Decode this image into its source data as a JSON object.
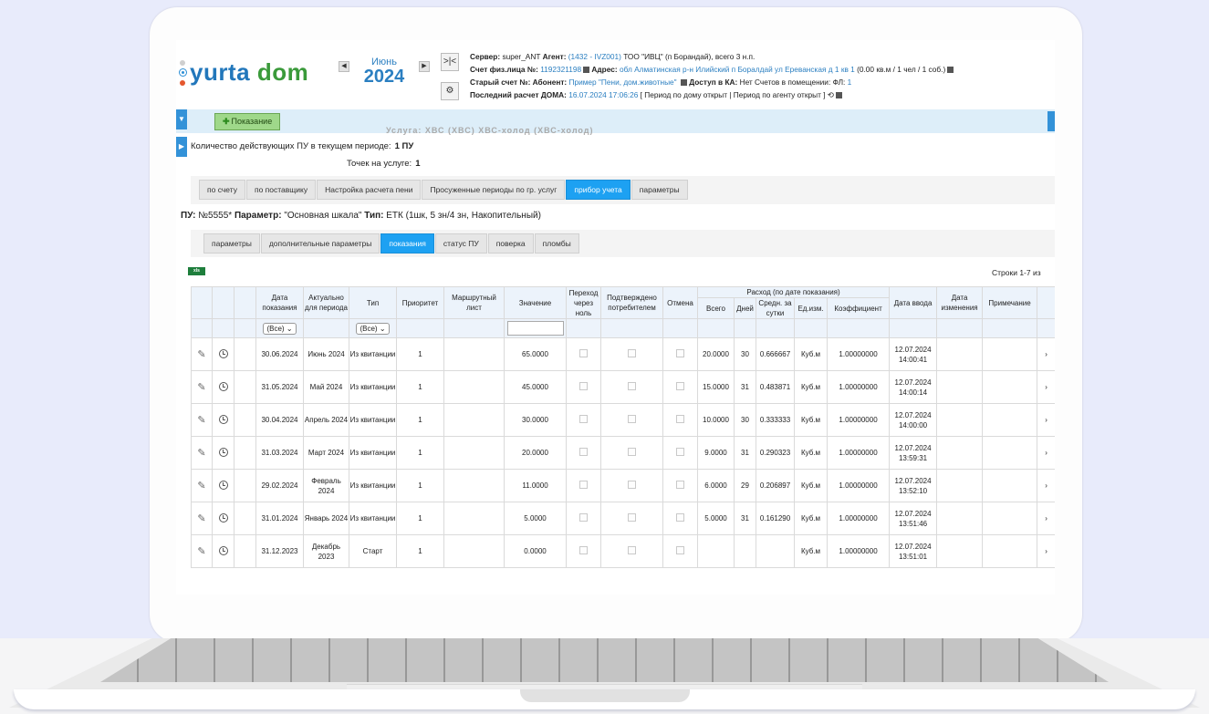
{
  "app": {
    "logo_left": "yurta",
    "logo_right": "dom"
  },
  "period": {
    "month": "Июнь",
    "year": "2024",
    "nav_prev": "◀",
    "nav_next": "▶"
  },
  "side_buttons": {
    "shift": ">|<",
    "settings": "⚙"
  },
  "info": {
    "server_label": "Сервер:",
    "server": "super_ANT",
    "agent_label": "Агент:",
    "agent_link": "(1432 - IVZ001)",
    "agent_rest": "ТОО \"ИВЦ\" (п Борандай), всего 3 н.п.",
    "account_label": "Счет физ.лица №:",
    "account": "1192321198",
    "address_label": "Адрес:",
    "address": "обл Алматинская р-н Илийский п Боралдай ул Ереванская д 1 кв 1",
    "address_rest": "(0.00 кв.м / 1 чел / 1 соб.)",
    "old_label": "Старый счет №:",
    "subscriber_label": "Абонент:",
    "subscriber": "Пример \"Пени, дом.животные\"",
    "access_label": "Доступ в КА:",
    "access": "Нет Счетов в помещении:",
    "fl_label": "ФЛ:",
    "fl": "1",
    "last_label": "Последний расчет ДОМА:",
    "last_date": "16.07.2024 17:06:26",
    "last_rest": "[ Период по дому открыт | Период по агенту открыт ]"
  },
  "toolbar": {
    "pokazanie": "Показание",
    "ghost": "Услуга: ХВС (ХВС) ХВС-холод (ХВС-холод)"
  },
  "summary": {
    "count_label": "Количество действующих ПУ в текущем периоде:",
    "count": "1 ПУ",
    "points_label": "Точек на услуге:",
    "points": "1"
  },
  "tabs1": [
    "по счету",
    "по поставщику",
    "Настройка расчета пени",
    "Просуженные периоды по гр. услуг",
    "прибор учета",
    "параметры"
  ],
  "tabs1_active": "прибор учета",
  "pu_line": {
    "pu_label": "ПУ:",
    "pu": "№5555*",
    "param_label": "Параметр:",
    "param": "\"Основная шкала\"",
    "type_label": "Тип:",
    "type": "ЕТК (1шк, 5 зн/4 зн, Накопительный)"
  },
  "tabs2": [
    "параметры",
    "дополнительные параметры",
    "показания",
    "статус ПУ",
    "поверка",
    "пломбы"
  ],
  "tabs2_active": "показания",
  "grid": {
    "xls": "xls",
    "rows_info": "Строки 1-7 из",
    "headers": {
      "date": "Дата показания",
      "actual": "Актуально для периода",
      "type": "Тип",
      "priority": "Приоритет",
      "route": "Маршрутный лист",
      "value": "Значение",
      "zero": "Переход через ноль",
      "confirmed": "Подтверждено потребителем",
      "cancel": "Отмена",
      "expense": "Расход (по дате показания)",
      "total": "Всего",
      "days": "Дней",
      "avg": "Средн. за сутки",
      "unit": "Ед.изм.",
      "coef": "Коэффициент",
      "entry": "Дата ввода",
      "changed": "Дата изменения",
      "note": "Примечание"
    },
    "filter_all": "(Все)",
    "rows": [
      {
        "date": "30.06.2024",
        "actual": "Июнь 2024",
        "type": "Из квитанции",
        "priority": "1",
        "value": "65.0000",
        "total": "20.0000",
        "days": "30",
        "avg": "0.666667",
        "unit": "Куб.м",
        "coef": "1.00000000",
        "entry_d": "12.07.2024",
        "entry_t": "14:00:41"
      },
      {
        "date": "31.05.2024",
        "actual": "Май 2024",
        "type": "Из квитанции",
        "priority": "1",
        "value": "45.0000",
        "total": "15.0000",
        "days": "31",
        "avg": "0.483871",
        "unit": "Куб.м",
        "coef": "1.00000000",
        "entry_d": "12.07.2024",
        "entry_t": "14:00:14"
      },
      {
        "date": "30.04.2024",
        "actual": "Апрель 2024",
        "type": "Из квитанции",
        "priority": "1",
        "value": "30.0000",
        "total": "10.0000",
        "days": "30",
        "avg": "0.333333",
        "unit": "Куб.м",
        "coef": "1.00000000",
        "entry_d": "12.07.2024",
        "entry_t": "14:00:00"
      },
      {
        "date": "31.03.2024",
        "actual": "Март 2024",
        "type": "Из квитанции",
        "priority": "1",
        "value": "20.0000",
        "total": "9.0000",
        "days": "31",
        "avg": "0.290323",
        "unit": "Куб.м",
        "coef": "1.00000000",
        "entry_d": "12.07.2024",
        "entry_t": "13:59:31"
      },
      {
        "date": "29.02.2024",
        "actual": "Февраль 2024",
        "type": "Из квитанции",
        "priority": "1",
        "value": "11.0000",
        "total": "6.0000",
        "days": "29",
        "avg": "0.206897",
        "unit": "Куб.м",
        "coef": "1.00000000",
        "entry_d": "12.07.2024",
        "entry_t": "13:52:10"
      },
      {
        "date": "31.01.2024",
        "actual": "Январь 2024",
        "type": "Из квитанции",
        "priority": "1",
        "value": "5.0000",
        "total": "5.0000",
        "days": "31",
        "avg": "0.161290",
        "unit": "Куб.м",
        "coef": "1.00000000",
        "entry_d": "12.07.2024",
        "entry_t": "13:51:46"
      },
      {
        "date": "31.12.2023",
        "actual": "Декабрь 2023",
        "type": "Старт",
        "priority": "1",
        "value": "0.0000",
        "total": "",
        "days": "",
        "avg": "",
        "unit": "Куб.м",
        "coef": "1.00000000",
        "entry_d": "12.07.2024",
        "entry_t": "13:51:01"
      }
    ]
  }
}
